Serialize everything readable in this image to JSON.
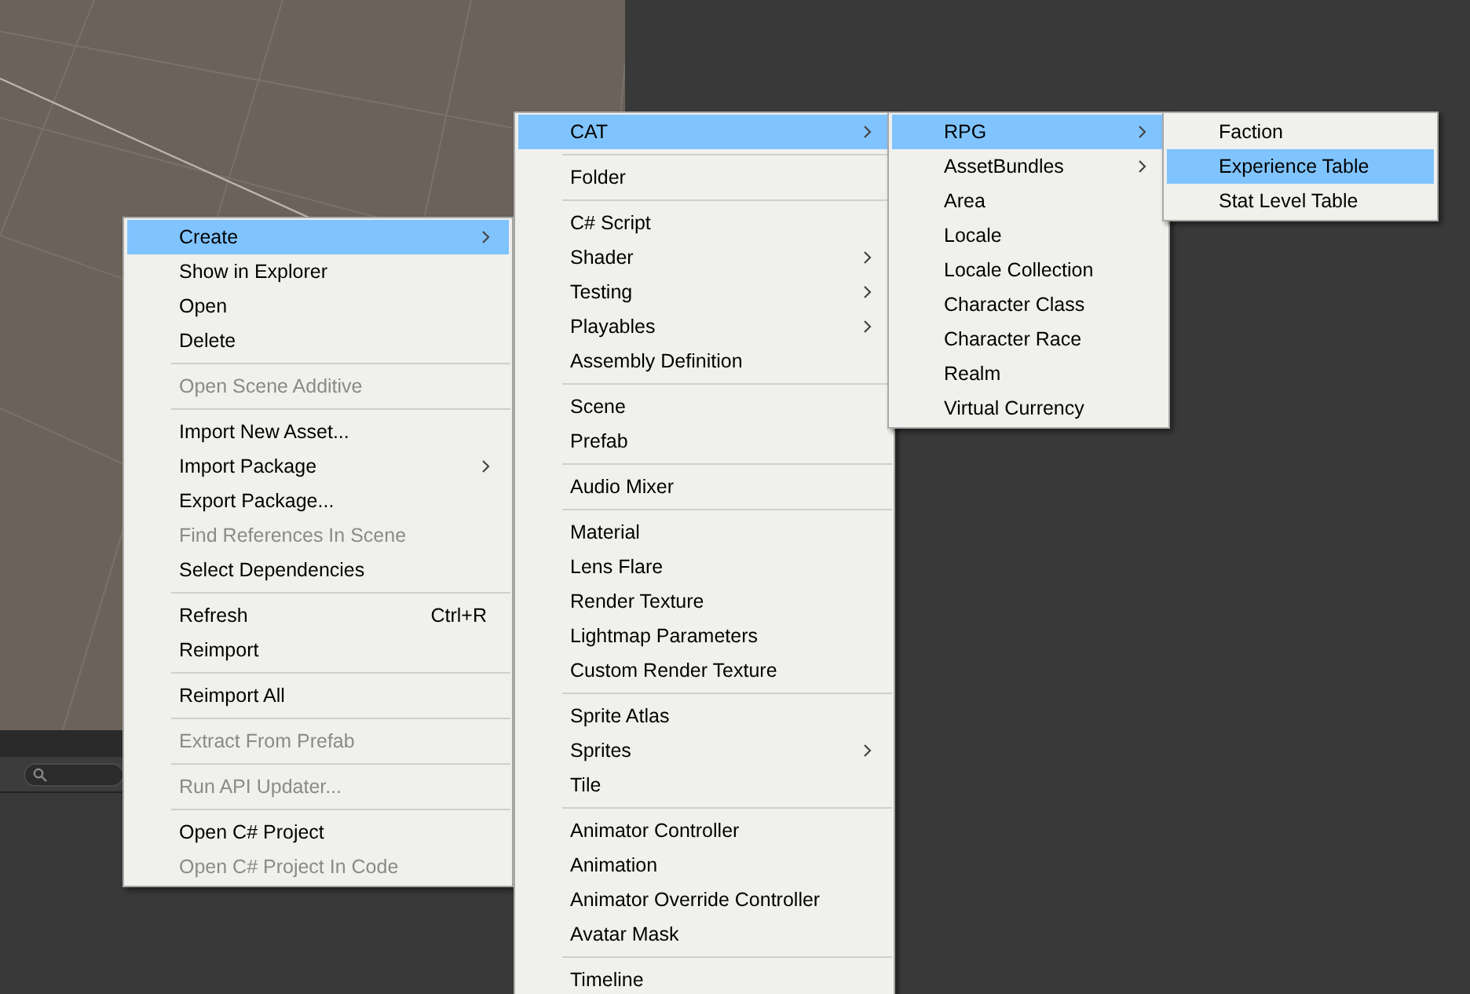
{
  "menus": [
    {
      "items": [
        {
          "kind": "item",
          "label": "Create",
          "submenu": true,
          "disabled": false,
          "selected": true
        },
        {
          "kind": "item",
          "label": "Show in Explorer",
          "submenu": false,
          "disabled": false,
          "selected": false
        },
        {
          "kind": "item",
          "label": "Open",
          "submenu": false,
          "disabled": false,
          "selected": false
        },
        {
          "kind": "item",
          "label": "Delete",
          "submenu": false,
          "disabled": false,
          "selected": false
        },
        {
          "kind": "separator"
        },
        {
          "kind": "item",
          "label": "Open Scene Additive",
          "submenu": false,
          "disabled": true,
          "selected": false
        },
        {
          "kind": "separator"
        },
        {
          "kind": "item",
          "label": "Import New Asset...",
          "submenu": false,
          "disabled": false,
          "selected": false
        },
        {
          "kind": "item",
          "label": "Import Package",
          "submenu": true,
          "disabled": false,
          "selected": false
        },
        {
          "kind": "item",
          "label": "Export Package...",
          "submenu": false,
          "disabled": false,
          "selected": false
        },
        {
          "kind": "item",
          "label": "Find References In Scene",
          "submenu": false,
          "disabled": true,
          "selected": false
        },
        {
          "kind": "item",
          "label": "Select Dependencies",
          "submenu": false,
          "disabled": false,
          "selected": false
        },
        {
          "kind": "separator"
        },
        {
          "kind": "item",
          "label": "Refresh",
          "shortcut": "Ctrl+R",
          "submenu": false,
          "disabled": false,
          "selected": false
        },
        {
          "kind": "item",
          "label": "Reimport",
          "submenu": false,
          "disabled": false,
          "selected": false
        },
        {
          "kind": "separator"
        },
        {
          "kind": "item",
          "label": "Reimport All",
          "submenu": false,
          "disabled": false,
          "selected": false
        },
        {
          "kind": "separator"
        },
        {
          "kind": "item",
          "label": "Extract From Prefab",
          "submenu": false,
          "disabled": true,
          "selected": false
        },
        {
          "kind": "separator"
        },
        {
          "kind": "item",
          "label": "Run API Updater...",
          "submenu": false,
          "disabled": true,
          "selected": false
        },
        {
          "kind": "separator"
        },
        {
          "kind": "item",
          "label": "Open C# Project",
          "submenu": false,
          "disabled": false,
          "selected": false
        },
        {
          "kind": "item",
          "label": "Open C# Project In Code",
          "submenu": false,
          "disabled": true,
          "selected": false
        }
      ]
    },
    {
      "items": [
        {
          "kind": "item",
          "label": "CAT",
          "submenu": true,
          "disabled": false,
          "selected": true
        },
        {
          "kind": "separator"
        },
        {
          "kind": "item",
          "label": "Folder",
          "submenu": false,
          "disabled": false,
          "selected": false
        },
        {
          "kind": "separator"
        },
        {
          "kind": "item",
          "label": "C# Script",
          "submenu": false,
          "disabled": false,
          "selected": false
        },
        {
          "kind": "item",
          "label": "Shader",
          "submenu": true,
          "disabled": false,
          "selected": false
        },
        {
          "kind": "item",
          "label": "Testing",
          "submenu": true,
          "disabled": false,
          "selected": false
        },
        {
          "kind": "item",
          "label": "Playables",
          "submenu": true,
          "disabled": false,
          "selected": false
        },
        {
          "kind": "item",
          "label": "Assembly Definition",
          "submenu": false,
          "disabled": false,
          "selected": false
        },
        {
          "kind": "separator"
        },
        {
          "kind": "item",
          "label": "Scene",
          "submenu": false,
          "disabled": false,
          "selected": false
        },
        {
          "kind": "item",
          "label": "Prefab",
          "submenu": false,
          "disabled": false,
          "selected": false
        },
        {
          "kind": "separator"
        },
        {
          "kind": "item",
          "label": "Audio Mixer",
          "submenu": false,
          "disabled": false,
          "selected": false
        },
        {
          "kind": "separator"
        },
        {
          "kind": "item",
          "label": "Material",
          "submenu": false,
          "disabled": false,
          "selected": false
        },
        {
          "kind": "item",
          "label": "Lens Flare",
          "submenu": false,
          "disabled": false,
          "selected": false
        },
        {
          "kind": "item",
          "label": "Render Texture",
          "submenu": false,
          "disabled": false,
          "selected": false
        },
        {
          "kind": "item",
          "label": "Lightmap Parameters",
          "submenu": false,
          "disabled": false,
          "selected": false
        },
        {
          "kind": "item",
          "label": "Custom Render Texture",
          "submenu": false,
          "disabled": false,
          "selected": false
        },
        {
          "kind": "separator"
        },
        {
          "kind": "item",
          "label": "Sprite Atlas",
          "submenu": false,
          "disabled": false,
          "selected": false
        },
        {
          "kind": "item",
          "label": "Sprites",
          "submenu": true,
          "disabled": false,
          "selected": false
        },
        {
          "kind": "item",
          "label": "Tile",
          "submenu": false,
          "disabled": false,
          "selected": false
        },
        {
          "kind": "separator"
        },
        {
          "kind": "item",
          "label": "Animator Controller",
          "submenu": false,
          "disabled": false,
          "selected": false
        },
        {
          "kind": "item",
          "label": "Animation",
          "submenu": false,
          "disabled": false,
          "selected": false
        },
        {
          "kind": "item",
          "label": "Animator Override Controller",
          "submenu": false,
          "disabled": false,
          "selected": false
        },
        {
          "kind": "item",
          "label": "Avatar Mask",
          "submenu": false,
          "disabled": false,
          "selected": false
        },
        {
          "kind": "separator"
        },
        {
          "kind": "item",
          "label": "Timeline",
          "submenu": false,
          "disabled": false,
          "selected": false
        }
      ]
    },
    {
      "items": [
        {
          "kind": "item",
          "label": "RPG",
          "submenu": true,
          "disabled": false,
          "selected": true
        },
        {
          "kind": "item",
          "label": "AssetBundles",
          "submenu": true,
          "disabled": false,
          "selected": false
        },
        {
          "kind": "item",
          "label": "Area",
          "submenu": false,
          "disabled": false,
          "selected": false
        },
        {
          "kind": "item",
          "label": "Locale",
          "submenu": false,
          "disabled": false,
          "selected": false
        },
        {
          "kind": "item",
          "label": "Locale Collection",
          "submenu": false,
          "disabled": false,
          "selected": false
        },
        {
          "kind": "item",
          "label": "Character Class",
          "submenu": false,
          "disabled": false,
          "selected": false
        },
        {
          "kind": "item",
          "label": "Character Race",
          "submenu": false,
          "disabled": false,
          "selected": false
        },
        {
          "kind": "item",
          "label": "Realm",
          "submenu": false,
          "disabled": false,
          "selected": false
        },
        {
          "kind": "item",
          "label": "Virtual Currency",
          "submenu": false,
          "disabled": false,
          "selected": false
        }
      ]
    },
    {
      "items": [
        {
          "kind": "item",
          "label": "Faction",
          "submenu": false,
          "disabled": false,
          "selected": false
        },
        {
          "kind": "item",
          "label": "Experience Table",
          "submenu": false,
          "disabled": false,
          "selected": true
        },
        {
          "kind": "item",
          "label": "Stat Level Table",
          "submenu": false,
          "disabled": false,
          "selected": false
        }
      ]
    }
  ]
}
